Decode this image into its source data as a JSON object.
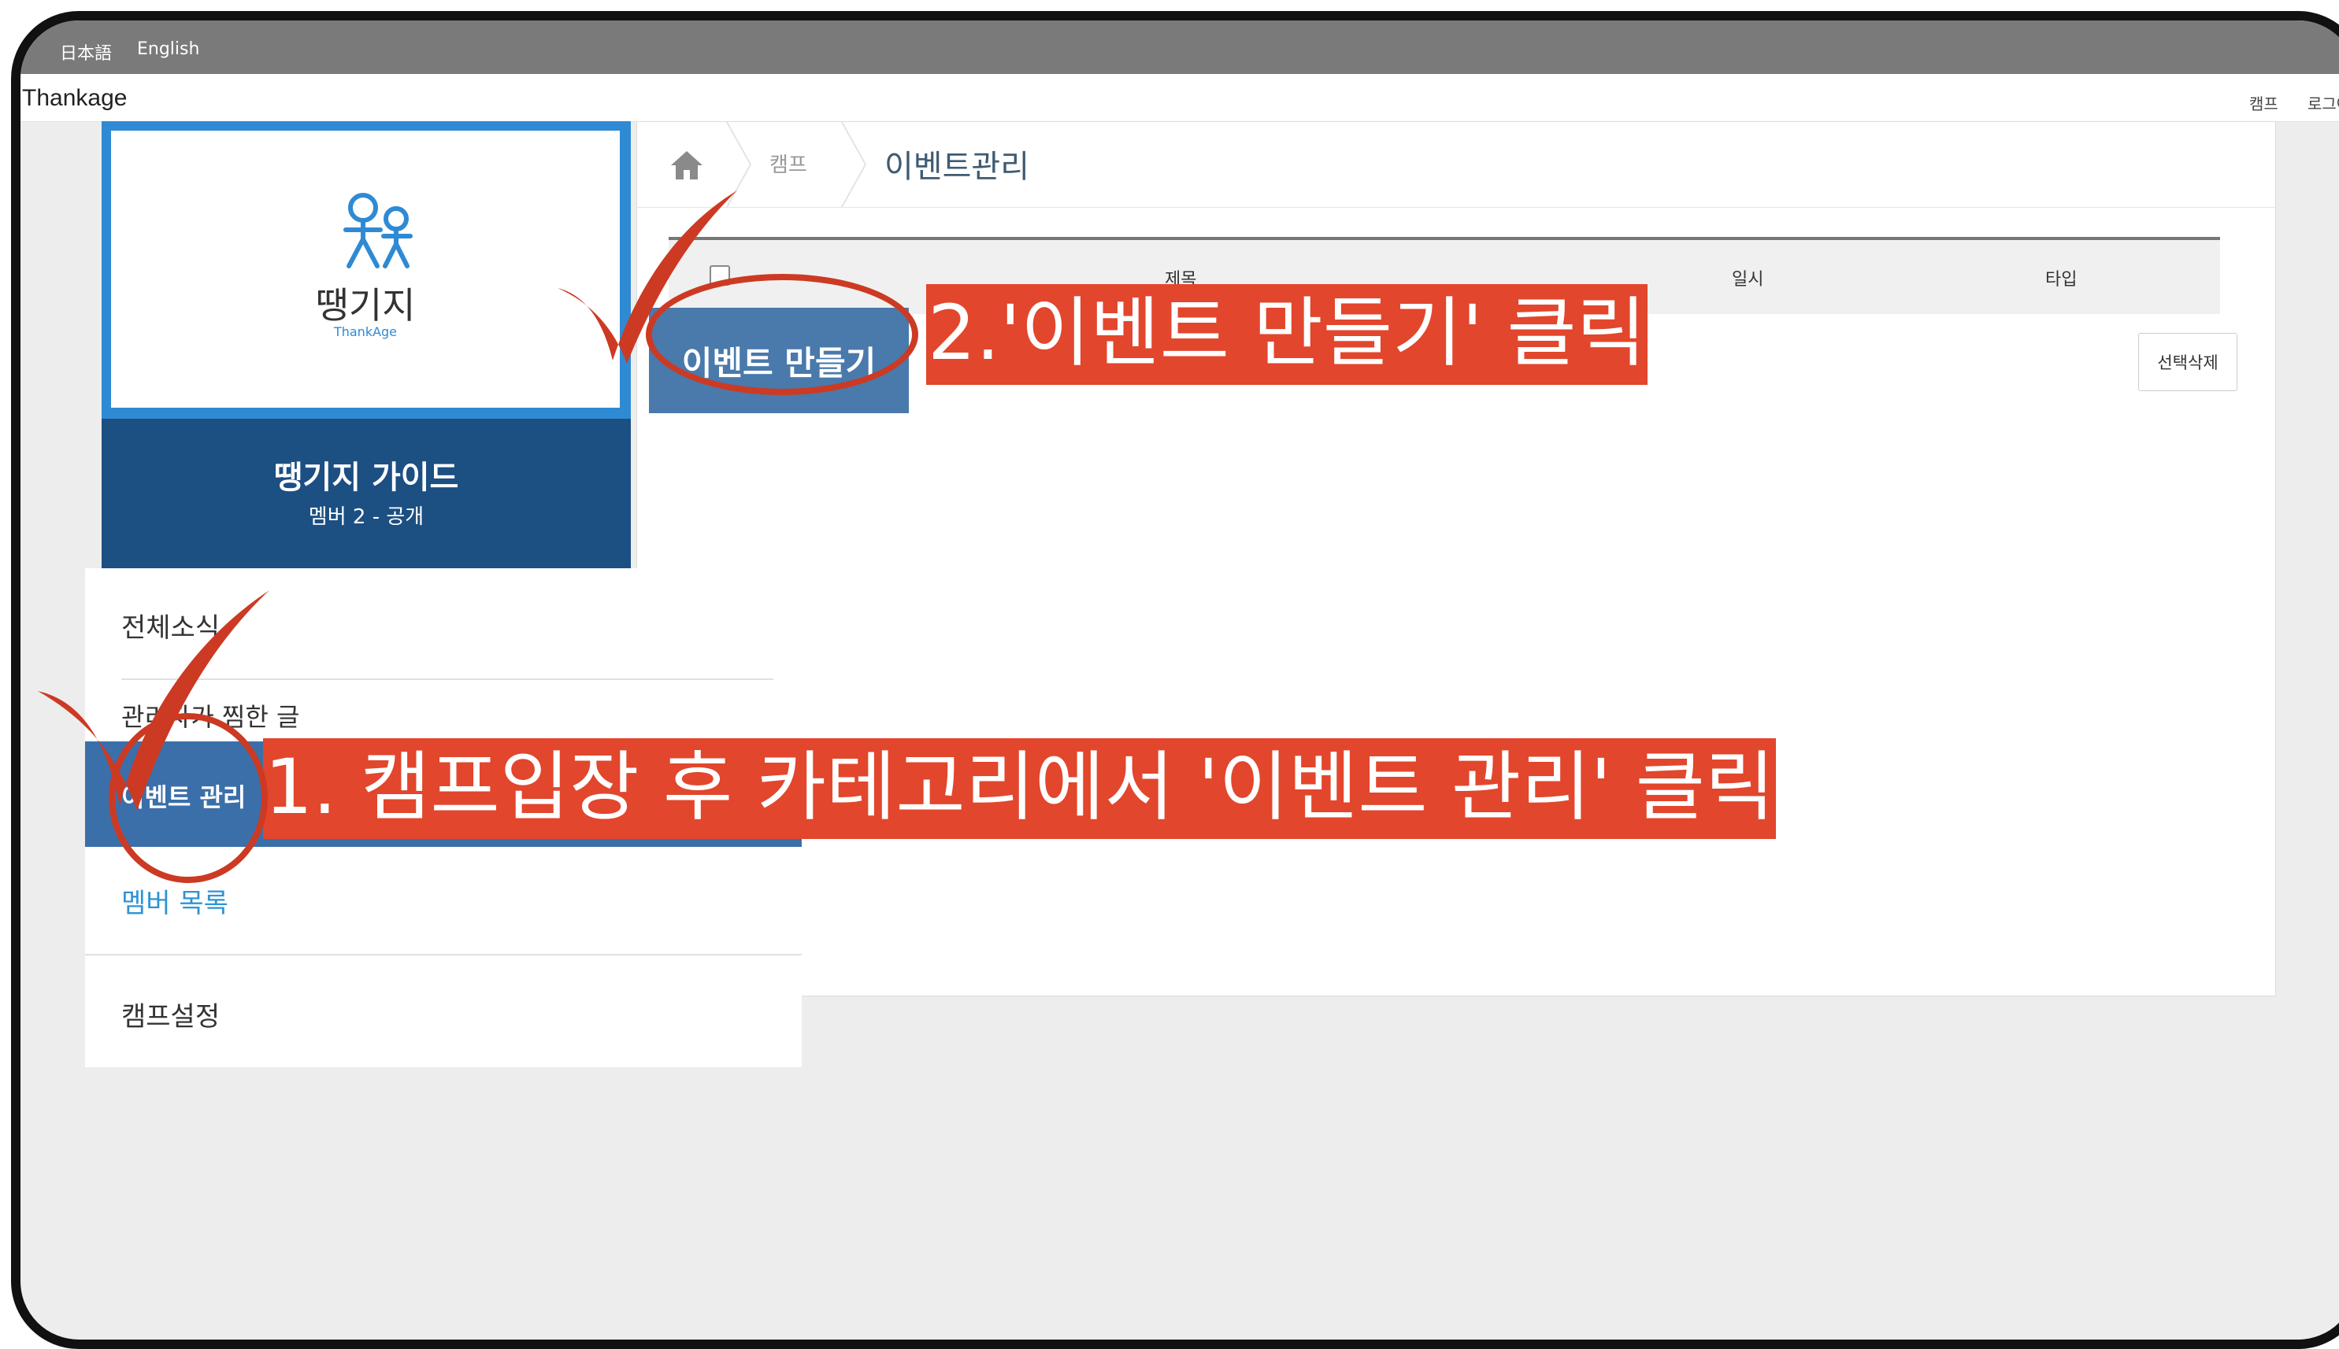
{
  "language_bar": {
    "japanese": "日本語",
    "english": "English"
  },
  "app": {
    "brand": "Thankage",
    "top_links": [
      "캠프",
      "로그아"
    ]
  },
  "breadcrumb": {
    "home_icon": "home-icon",
    "parent": "캠프",
    "current": "이벤트관리"
  },
  "table": {
    "columns": [
      "제목",
      "일시",
      "타입"
    ],
    "create_button": "이벤트 만들기",
    "delete_button": "선택삭제"
  },
  "camp": {
    "logo_text": "땡기지",
    "logo_sub": "ThankAge",
    "name": "땡기지 가이드",
    "meta": "멤버 2 - 공개"
  },
  "menu": {
    "items": [
      {
        "label": "전체소식"
      },
      {
        "label": "관리자가 찜한 글"
      },
      {
        "label": "이벤트 관리"
      },
      {
        "label": "멤버 목록"
      },
      {
        "label": "캠프설정"
      }
    ]
  },
  "annotations": {
    "step2": "2.'이벤트 만들기' 클릭",
    "step1": "1. 캠프입장 후 카테고리에서 '이벤트 관리' 클릭"
  },
  "colors": {
    "accent": "#e2462c",
    "primary": "#3b6faa",
    "sidebar_dark": "#1c4f82",
    "sidebar_border": "#2f8ad4"
  }
}
